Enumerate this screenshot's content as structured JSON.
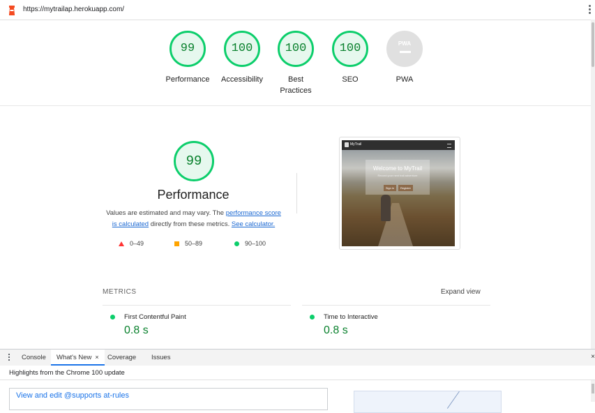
{
  "topbar": {
    "url": "https://mytrailap.herokuapp.com/"
  },
  "colors": {
    "pass": "#0cce6b",
    "pass_text": "#08802c",
    "average": "#ffa400",
    "fail": "#ff3333",
    "pwa_grey": "#e0e0e0"
  },
  "gauges": [
    {
      "score": "99",
      "label": "Performance"
    },
    {
      "score": "100",
      "label": "Accessibility"
    },
    {
      "score": "100",
      "label_line1": "Best",
      "label_line2": "Practices"
    },
    {
      "score": "100",
      "label": "SEO"
    },
    {
      "badge": "PWA",
      "label": "PWA"
    }
  ],
  "performance": {
    "score": "99",
    "title": "Performance",
    "desc_before": "Values are estimated and may vary. The ",
    "desc_link1_line1": "performance score",
    "desc_link1_line2": "is calculated",
    "desc_middle": " directly from these metrics. ",
    "desc_link2": "See calculator.",
    "legend": [
      {
        "shape": "triangle",
        "range": "0–49"
      },
      {
        "shape": "square",
        "range": "50–89"
      },
      {
        "shape": "circle",
        "range": "90–100"
      }
    ]
  },
  "screenshot": {
    "brand": "MyTrail",
    "welcome": "Welcome to MyTrail",
    "subtitle": "Record your next trail adventure",
    "sign_in": "Sign in",
    "register": "Register"
  },
  "metrics": {
    "heading": "METRICS",
    "expand": "Expand view",
    "items": [
      {
        "name": "First Contentful Paint",
        "value": "0.8 s"
      },
      {
        "name": "Time to Interactive",
        "value": "0.8 s"
      }
    ]
  },
  "drawer": {
    "tabs": [
      "Console",
      "What's New",
      "Coverage",
      "Issues"
    ],
    "active_tab": "What's New",
    "close_glyph": "×",
    "panel_close": "×",
    "subtitle": "Highlights from the Chrome 100 update",
    "news_link": "View and edit @supports at-rules"
  }
}
